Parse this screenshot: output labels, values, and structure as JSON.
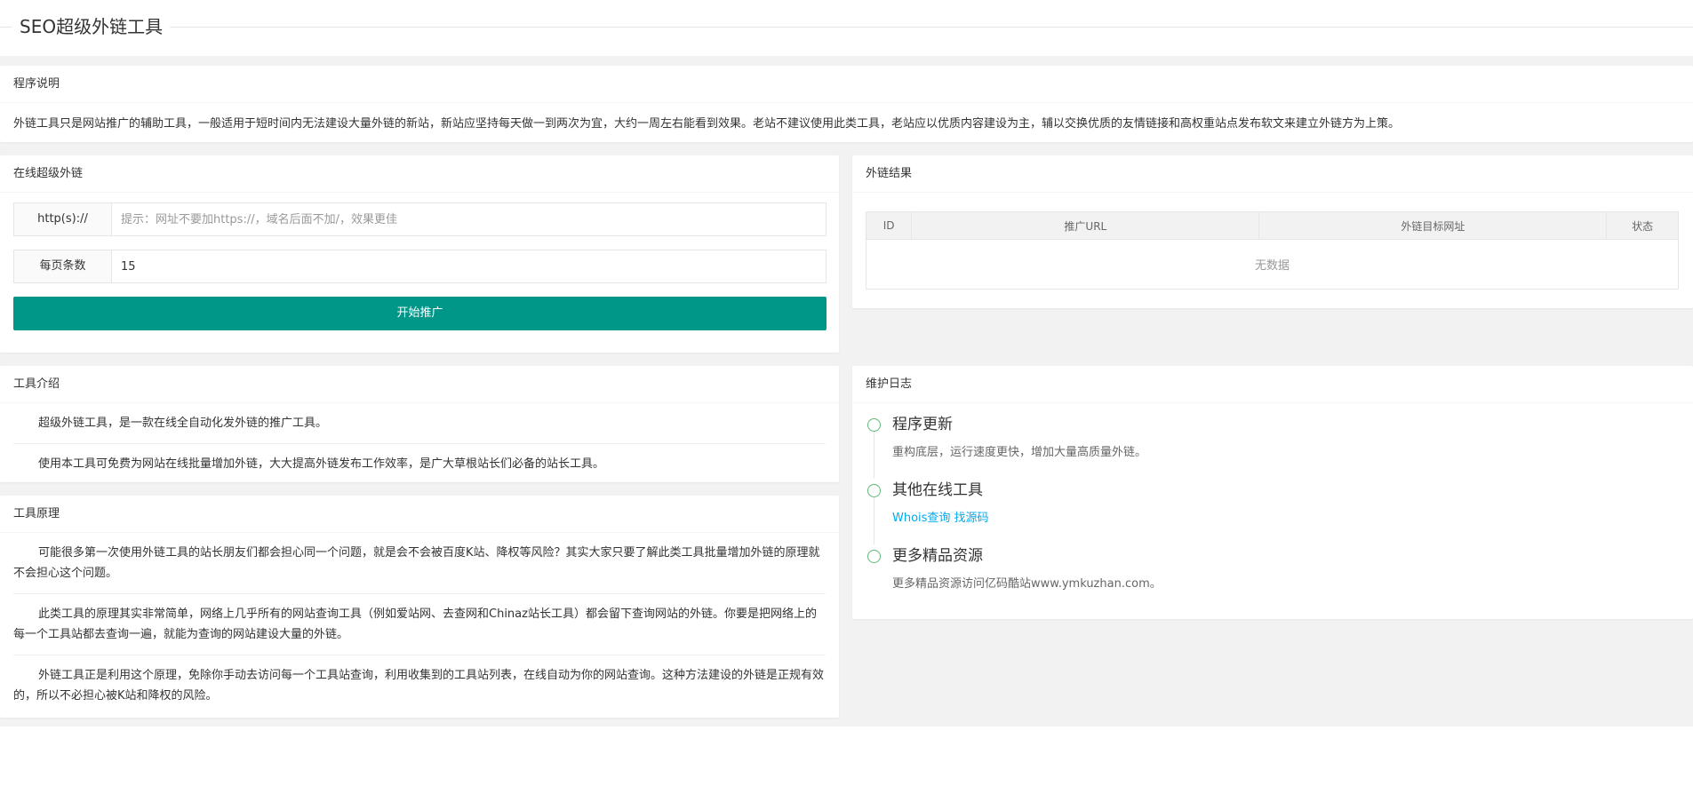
{
  "header": {
    "title": "SEO超级外链工具"
  },
  "intro": {
    "title": "程序说明",
    "text": "外链工具只是网站推广的辅助工具，一般适用于短时间内无法建设大量外链的新站，新站应坚持每天做一到两次为宜，大约一周左右能看到效果。老站不建议使用此类工具，老站应以优质内容建设为主，辅以交换优质的友情链接和高权重站点发布软文来建立外链方为上策。"
  },
  "online": {
    "title": "在线超级外链",
    "url_label": "http(s)://",
    "url_placeholder": "提示：网址不要加https://，域名后面不加/，效果更佳",
    "url_value": "",
    "count_label": "每页条数",
    "count_value": "15",
    "submit_label": "开始推广"
  },
  "result": {
    "title": "外链结果",
    "columns": [
      "ID",
      "推广URL",
      "外链目标网址",
      "状态"
    ],
    "empty_text": "无数据"
  },
  "tool": {
    "title": "工具介绍",
    "paragraphs": [
      "超级外链工具，是一款在线全自动化发外链的推广工具。",
      "使用本工具可免费为网站在线批量增加外链，大大提高外链发布工作效率，是广大草根站长们必备的站长工具。"
    ]
  },
  "principle": {
    "title": "工具原理",
    "paragraphs": [
      "可能很多第一次使用外链工具的站长朋友们都会担心同一个问题，就是会不会被百度K站、降权等风险？其实大家只要了解此类工具批量增加外链的原理就不会担心这个问题。",
      "此类工具的原理其实非常简单，网络上几乎所有的网站查询工具（例如爱站网、去查网和Chinaz站长工具）都会留下查询网站的外链。你要是把网络上的每一个工具站都去查询一遍，就能为查询的网站建设大量的外链。",
      "外链工具正是利用这个原理，免除你手动去访问每一个工具站查询，利用收集到的工具站列表，在线自动为你的网站查询。这种方法建设的外链是正规有效的，所以不必担心被K站和降权的风险。"
    ]
  },
  "log": {
    "title": "维护日志",
    "items": [
      {
        "title": "程序更新",
        "desc": "重构底层，运行速度更快，增加大量高质量外链。"
      },
      {
        "title": "其他在线工具",
        "links": [
          "Whois查询",
          "找源码"
        ]
      },
      {
        "title": "更多精品资源",
        "desc": "更多精品资源访问亿码酷站www.ymkuzhan.com。"
      }
    ]
  },
  "colors": {
    "primary": "#009688",
    "link": "#01aaed",
    "timeline_dot": "#5fb878",
    "background": "#f2f2f2"
  }
}
